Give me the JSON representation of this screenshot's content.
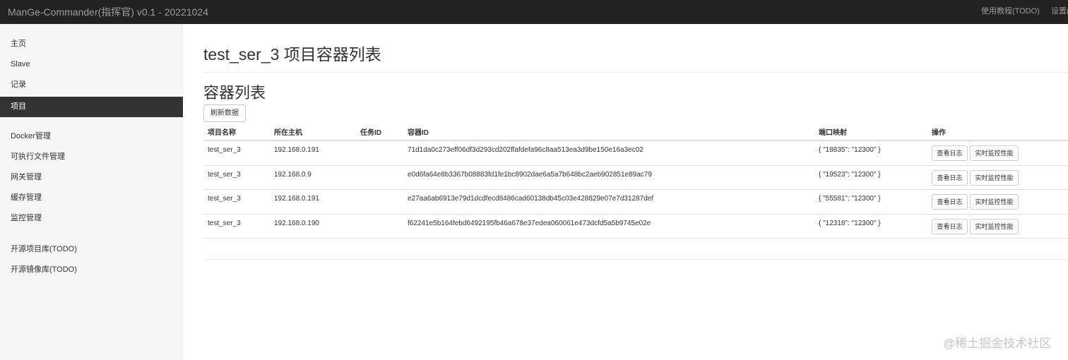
{
  "topbar": {
    "brand": "ManGe-Commander(指挥官) v0.1 - 20221024",
    "help_link": "使用教程(TODO)",
    "settings_link": "设置("
  },
  "sidebar": {
    "items": [
      {
        "label": "主页"
      },
      {
        "label": "Slave"
      },
      {
        "label": "记录"
      },
      {
        "label": "项目"
      },
      {
        "label": "Docker管理"
      },
      {
        "label": "可执行文件管理"
      },
      {
        "label": "网关管理"
      },
      {
        "label": "缓存管理"
      },
      {
        "label": "监控管理"
      },
      {
        "label": "开源项目库(TODO)"
      },
      {
        "label": "开源镜像库(TODO)"
      }
    ],
    "active_item": "项目"
  },
  "main": {
    "page_title": "test_ser_3 项目容器列表",
    "section_title": "容器列表",
    "refresh_button": "刷新数据",
    "table": {
      "headers": [
        "项目名称",
        "所在主机",
        "任务ID",
        "容器ID",
        "端口映射",
        "操作"
      ],
      "rows": [
        {
          "project": "test_ser_3",
          "host": "192.168.0.191",
          "task_id": "",
          "container_id": "71d1da0c273eff06df3d293cd202ffafdefa96c8aa513ea3d9be150e16a3ec02",
          "ports": "{ \"18835\": \"12300\" }"
        },
        {
          "project": "test_ser_3",
          "host": "192.168.0.9",
          "task_id": "",
          "container_id": "e0d6fa64e8b3367b08883fd1fe1bc8902dae6a5a7b648bc2aeb902851e89ac79",
          "ports": "{ \"19523\": \"12300\" }"
        },
        {
          "project": "test_ser_3",
          "host": "192.168.0.191",
          "task_id": "",
          "container_id": "e27aa6ab6913e79d1dcdfecd8486cad60138db45c03e428829e07e7d31287def",
          "ports": "{ \"55581\": \"12300\" }"
        },
        {
          "project": "test_ser_3",
          "host": "192.168.0.190",
          "task_id": "",
          "container_id": "f62241e5b164febd6492195fb46a678e37edea060061e473dcfd5a5b9745e02e",
          "ports": "{ \"12318\": \"12300\" }"
        }
      ],
      "action_log": "查看日志",
      "action_monitor": "实时监控性能"
    }
  },
  "watermark": "@稀土掘金技术社区"
}
